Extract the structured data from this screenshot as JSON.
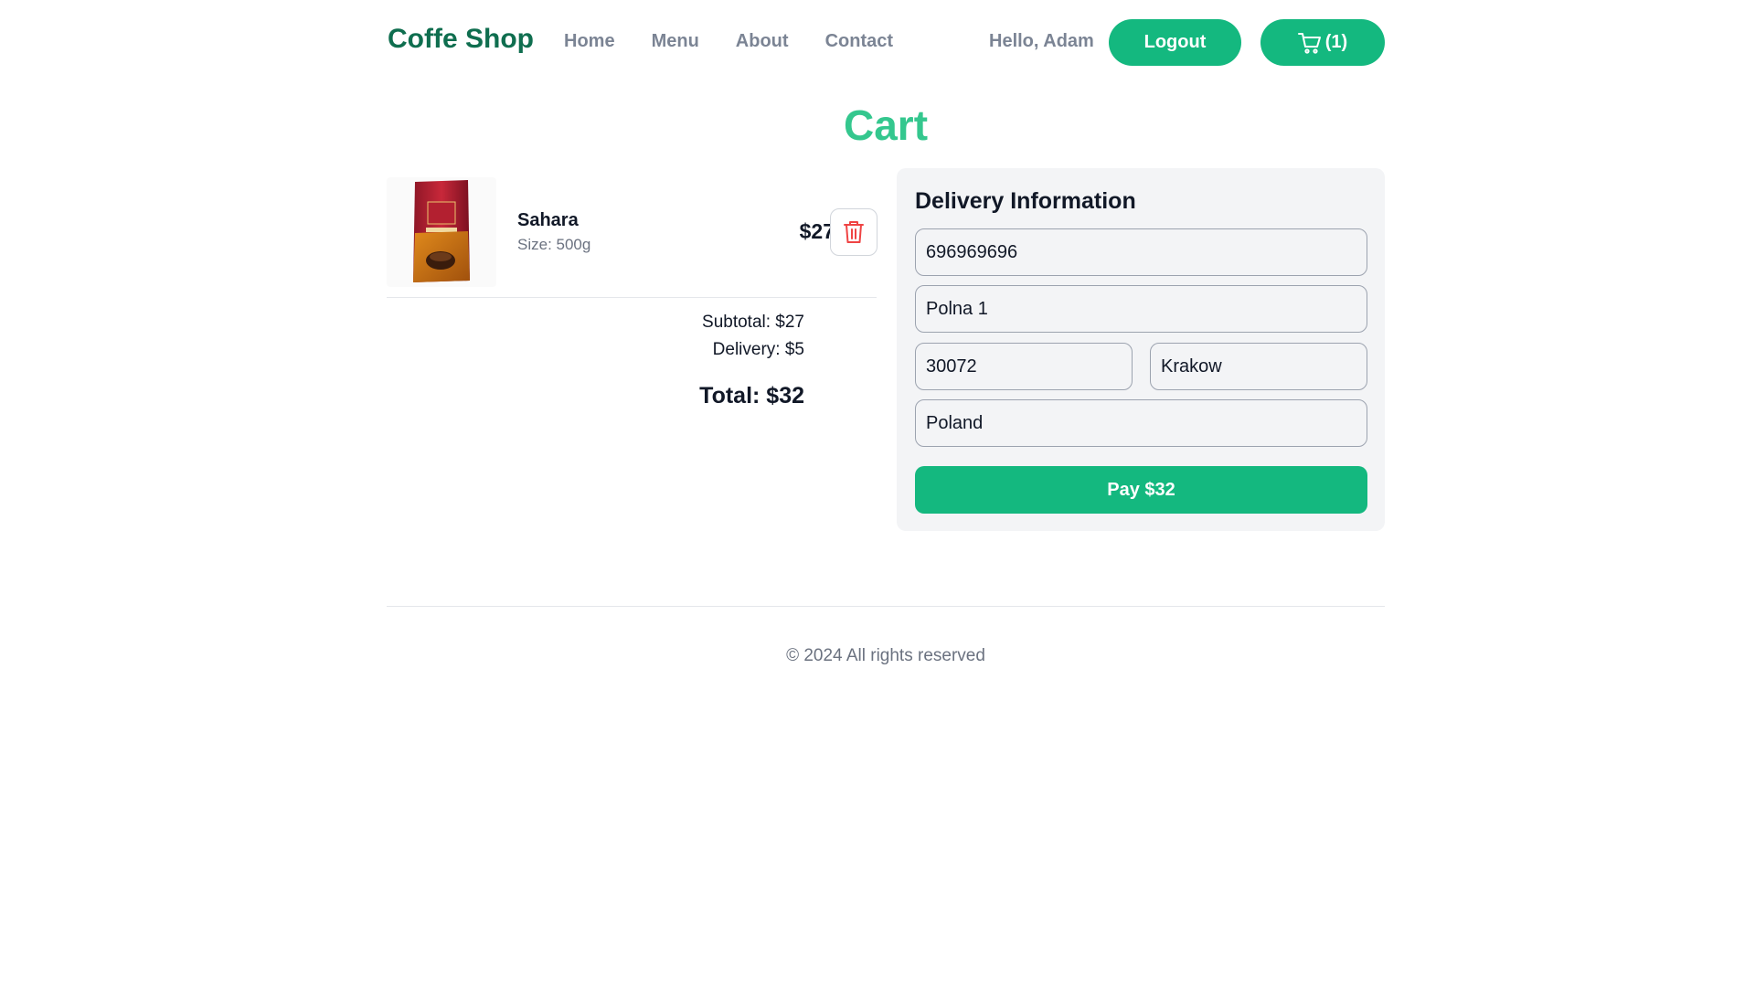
{
  "header": {
    "brand": "Coffe Shop",
    "nav": [
      "Home",
      "Menu",
      "About",
      "Contact"
    ],
    "greeting": "Hello, Adam",
    "logout_label": "Logout",
    "cart_count_label": "(1)"
  },
  "page_title": "Cart",
  "cart": {
    "items": [
      {
        "name": "Sahara",
        "size": "Size: 500g",
        "price": "$27",
        "image_icon": "coffee-bag-image"
      }
    ],
    "subtotal": "Subtotal: $27",
    "delivery": "Delivery: $5",
    "total": "Total: $32"
  },
  "delivery_form": {
    "title": "Delivery Information",
    "phone": "696969696",
    "street": "Polna 1",
    "zip": "30072",
    "city": "Krakow",
    "country": "Poland",
    "pay_label": "Pay $32"
  },
  "footer": {
    "text": "© 2024 All rights reserved"
  },
  "colors": {
    "accent": "#14b87f",
    "brand": "#0f6e4f",
    "title": "#34c78e",
    "delete": "#ef4444"
  }
}
